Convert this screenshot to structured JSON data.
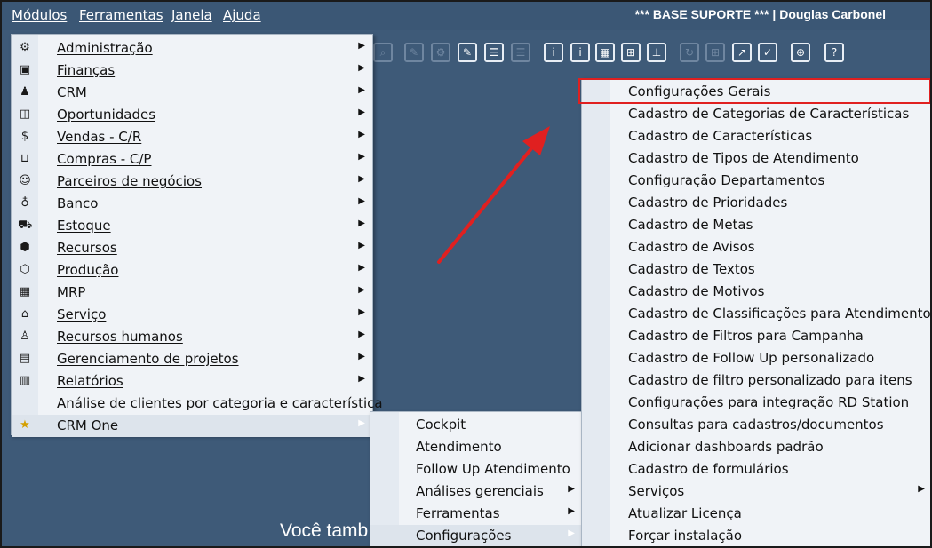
{
  "menubar": {
    "items": [
      {
        "label": "Módulos"
      },
      {
        "label": "Ferramentas"
      },
      {
        "label": "Janela"
      },
      {
        "label": "Ajuda"
      }
    ],
    "user_info": "*** BASE SUPORTE *** | Douglas Carbonel"
  },
  "toolbar": {
    "help_label": "?"
  },
  "background_text": "Você tamb",
  "main_menu": {
    "items": [
      {
        "label": "Administração",
        "icon": "gear-icon"
      },
      {
        "label": "Finanças",
        "icon": "finance-icon"
      },
      {
        "label": "CRM",
        "icon": "crm-icon"
      },
      {
        "label": "Oportunidades",
        "icon": "opportunities-icon"
      },
      {
        "label": "Vendas - C/R",
        "icon": "dollar-icon"
      },
      {
        "label": "Compras - C/P",
        "icon": "cart-icon"
      },
      {
        "label": "Parceiros de negócios",
        "icon": "partners-icon"
      },
      {
        "label": "Banco",
        "icon": "bank-bag-icon"
      },
      {
        "label": "Estoque",
        "icon": "stock-icon"
      },
      {
        "label": "Recursos",
        "icon": "cube-icon"
      },
      {
        "label": "Produção",
        "icon": "production-icon"
      },
      {
        "label": "MRP",
        "icon": "calendar-icon"
      },
      {
        "label": "Serviço",
        "icon": "building-icon"
      },
      {
        "label": "Recursos humanos",
        "icon": "person-icon"
      },
      {
        "label": "Gerenciamento de projetos",
        "icon": "project-icon"
      },
      {
        "label": "Relatórios",
        "icon": "report-icon"
      },
      {
        "label": "Análise de clientes por categoria e característica",
        "icon": ""
      },
      {
        "label": "CRM One",
        "icon": "crm-one-star-icon"
      }
    ]
  },
  "crmone_menu": {
    "items": [
      {
        "label": "Cockpit"
      },
      {
        "label": "Atendimento"
      },
      {
        "label": "Follow Up Atendimento"
      },
      {
        "label": "Análises gerenciais"
      },
      {
        "label": "Ferramentas"
      },
      {
        "label": "Configurações"
      }
    ]
  },
  "config_menu": {
    "items": [
      {
        "label": "Configurações Gerais"
      },
      {
        "label": "Cadastro de Categorias de Características"
      },
      {
        "label": "Cadastro de Características"
      },
      {
        "label": "Cadastro de Tipos de Atendimento"
      },
      {
        "label": "Configuração Departamentos"
      },
      {
        "label": "Cadastro de Prioridades"
      },
      {
        "label": "Cadastro de Metas"
      },
      {
        "label": "Cadastro de Avisos"
      },
      {
        "label": "Cadastro de Textos"
      },
      {
        "label": "Cadastro de Motivos"
      },
      {
        "label": "Cadastro de Classificações para Atendimento"
      },
      {
        "label": "Cadastro de Filtros para Campanha"
      },
      {
        "label": "Cadastro de Follow Up personalizado"
      },
      {
        "label": "Cadastro de filtro personalizado para itens"
      },
      {
        "label": "Configurações para integração RD Station"
      },
      {
        "label": "Consultas para cadastros/documentos"
      },
      {
        "label": "Adicionar dashboards padrão"
      },
      {
        "label": "Cadastro de formulários"
      },
      {
        "label": "Serviços"
      },
      {
        "label": "Atualizar Licença"
      },
      {
        "label": "Forçar instalação"
      }
    ]
  },
  "colors": {
    "background": "#3e5a78",
    "menu": "#f0f3f7",
    "highlight_border": "#e02020",
    "arrow": "#e02020"
  }
}
